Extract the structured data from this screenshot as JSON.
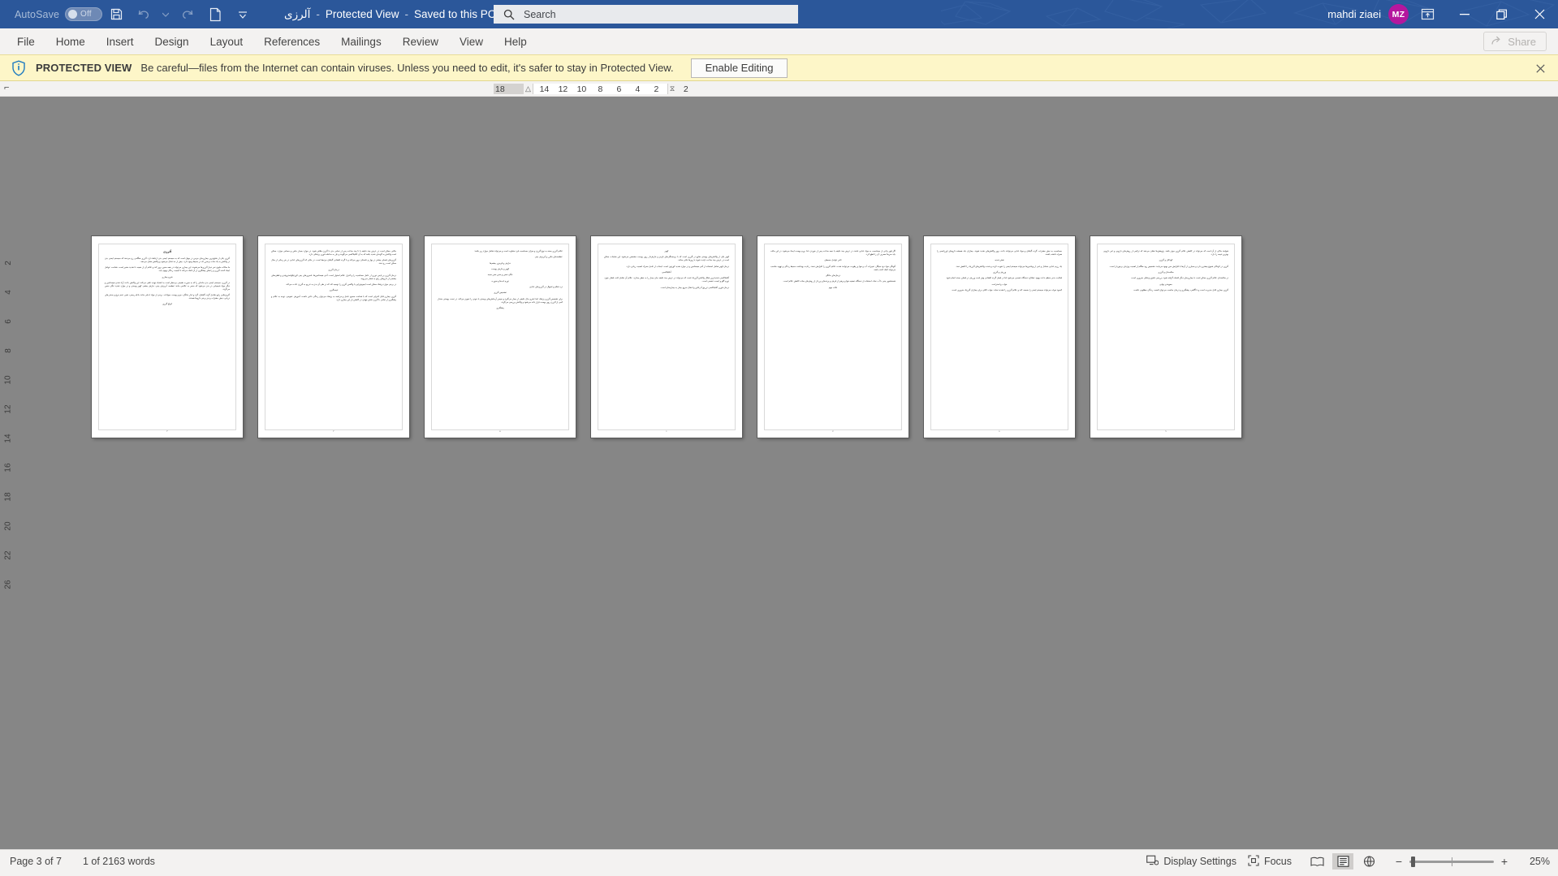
{
  "titlebar": {
    "autosave_label": "AutoSave",
    "autosave_state": "Off",
    "doc_name": "آلرزی",
    "protected_view": "Protected View",
    "saved_state": "Saved to this PC",
    "sep": "-",
    "caret": "▾",
    "icons": [
      "save-icon",
      "undo-icon",
      "redo-icon",
      "new-document-icon",
      "customize-quick-access-icon"
    ],
    "user_name": "mahdi ziaei",
    "user_initials": "MZ",
    "avatar_color": "#b5179e",
    "bar_color": "#2b579a",
    "window_controls": [
      "ribbon-display-options",
      "minimize",
      "restore",
      "close"
    ]
  },
  "search": {
    "placeholder": "Search",
    "value": ""
  },
  "ribbon": {
    "tabs": [
      {
        "label": "File"
      },
      {
        "label": "Home"
      },
      {
        "label": "Insert"
      },
      {
        "label": "Design"
      },
      {
        "label": "Layout"
      },
      {
        "label": "References"
      },
      {
        "label": "Mailings"
      },
      {
        "label": "Review"
      },
      {
        "label": "View"
      },
      {
        "label": "Help"
      }
    ],
    "share_label": "Share"
  },
  "protected_view_banner": {
    "title": "PROTECTED VIEW",
    "message": "Be careful—files from the Internet can contain viruses. Unless you need to edit, it's safer to stay in Protected View.",
    "button_label": "Enable Editing",
    "close_label": "✕",
    "background": "#fdf6c8"
  },
  "ruler": {
    "horizontal_numbers": [
      "18",
      "14",
      "12",
      "10",
      "8",
      "6",
      "4",
      "2",
      "2"
    ],
    "left_value": "18",
    "vertical_numbers": [
      "2",
      "4",
      "6",
      "8",
      "10",
      "12",
      "14",
      "16",
      "18",
      "20",
      "22",
      "26"
    ],
    "tab_stop_glyph": "⌐"
  },
  "statusbar": {
    "page_status": "Page 3 of 7",
    "word_count": "1 of 2163 words",
    "display_settings": "Display Settings",
    "focus": "Focus",
    "zoom_percent": "25%",
    "zoom_minus": "−",
    "zoom_plus": "+",
    "view_modes": [
      "read-mode",
      "print-layout",
      "web-layout"
    ],
    "active_view_mode": "print-layout"
  },
  "document": {
    "pages": [
      {
        "number": "۳",
        "title": "آلرژی",
        "paragraphs": [
          "آلرژی یکی از شایع‌ترین بیماری‌های مزمن در جهان است که به سیستم ایمنی بدن ارتباط دارد. آلرژی هنگامی رخ می‌دهد که سیستم ایمنی بدن در واکنش به یک ماده بی‌ضرر که در محیط وجود دارد، بیش از حد فعال می‌شود و واکنش نشان می‌دهد.",
          "ما سالانه ملیون نفر دچار آلرژی‌ها می‌شوند. این بیماری می‌تواند در همه سنین بروز کند و علائم آن از خفیف تا شدید متغیر است. شناخت عوامل ایجاد کننده آلرژی و راه‌های پیشگیری از آن کمک می‌کند تا کیفیت زندگی بهبود یابد.",
          "شرح بیماری",
          "در آلرژی، سیستم ایمنی بدن ماده‌ای را که به صورت طبیعی بی‌خطر است به اشتباه تهدید تلقی می‌کند. این واکنش باعث آزاد شدن هیستامین و دیگر مواد شیمیایی در بدن می‌شود که منجر به علائمی مانند عطسه، آبریزش بینی، خارش چشم، کهیر پوستی و در موارد شدید تنگی نفس می‌گردد.",
          "آلرژن‌هایی رایج شامل گرده گیاهان، گرد و غبار خانگی، مو و پوست حیوانات، برخی از مواد غذایی مانند بادام زمینی، شیر، تخم مرغ و صدف‌های دریایی، نیش حشرات و نیز برخی داروها هستند.",
          "انواع آلرژی"
        ]
      },
      {
        "number": "۴",
        "paragraphs": [
          "حالتی ممکن است در عرض چند دقیقه یا تا چند ساعت پس از تماس بدن با آلرژن ظاهر شود. در موارد بسیار خاص و حساس موارد، ممکن است واکنش به گونه‌ای شدید باشد که به آن آنافیلاکسی می‌گویند و نیاز به مداخله فوری پزشکی دارد.",
          "آلرژی‌های فصلی بیشتر در بهار و تابستان بروز می‌کند و با گرده افشانی گیاهان مرتبط است. در حالی که آلرژی‌های غذایی در هر زمانی از سال ممکن است رخ دهد.",
          "درمان آلرژی",
          "درمان آلرژی بر پایه‌ی دوری از عامل حساسیت زا و کنترل علائم استوار است. آنتی هیستامین‌ها، اسپری‌های بینی کورتیکواستروئیدی و قطره‌های چشمی از داروهای رایج به شمار می‌روند.",
          "در برخی موارد پزشک ممکن است ایمونوتراپی یا واکسن آلرژی را توصیه کند که در طی آن بدن به تدریج به آلرژن عادت می‌کند.",
          "نتیجه‌گیری",
          "آلرژی بیماری قابل کنترلی است که با شناخت صحیح عامل و مراجعه به پزشک می‌توان زندگی عادی داشت. آموزش عمومی، توجه به علائم و پیشگیری از تماس با آلرژن نقش مهمی در کاهش بار این بیماری دارد."
        ]
      },
      {
        "number": "۵",
        "paragraphs": [
          "علائم آلرژی بسته به نوع آلرژن و میزان حساسیت فرد متفاوت است و می‌تواند شامل موارد زیر باشد:",
          "عطسه‌های مکرر و آبریزش بینی",
          "خارش و قرمزی چشم‌ها",
          "کهیر و خارش پوست",
          "تنگی نفس و خس خس سینه",
          "تورم لب‌ها و صورت",
          "درد شکم و اسهال در آلرژی‌های غذایی",
          "تشخیص آلرژی",
          "برای تشخیص آلرژی پزشک ابتدا شرح حال دقیقی از بیمار می‌گیرد و سپس آزمایش‌های پوستی یا خونی را تجویز می‌کند. در تست پوستی مقدار کمی از آلرژن روی پوست قرار داده می‌شود و واکنش بررسی می‌گردد.",
          "پیشگیری"
        ]
      },
      {
        "number": "۶",
        "paragraphs": [
          "کهیر",
          "کهیر یکی از واکنش‌های پوستی شایع در آلرژی است که با برجستگی‌های قرمز و خارش‌دار روی پوست مشخص می‌شود. این ضایعات ممکن است در عرض چند ساعت ناپدید شوند یا روزها باقی بمانند.",
          "درمان کهیر شامل استفاده از آنتی هیستامین و در موارد شدید کورتون است. اجتناب از عامل محرک اهمیت زیادی دارد.",
          "آنافیلاکسی",
          "آنافیلاکسی شدیدترین شکل واکنش آلرژیک است که می‌تواند در عرض چند دقیقه جان بیمار را به خطر بیندازد. علائم آن شامل افت فشار خون، تورم گلو و ایست تنفسی است.",
          "درمان فوری آنافیلاکسی تزریق آدرنالین و انتقال سریع بیمار به بیمارستان است."
        ]
      },
      {
        "number": "۷",
        "paragraphs": [
          "اگر قهر بدانی از حساسیت به مواد غذایی باشد، در عرض چند دقیقه یا نیمه ساعت پس از خوردن غذا، ورم پوست ایجاد می‌شود. در این حالت باید سریعاً مصرف آن را قطع کرد.",
          "تاثیر عوامل محیطی",
          "آلودگی هوا، دود سیگار، تغییرات آب و هوا و رطوبت می‌توانند شدت علائم آلرژی را افزایش دهند. رعایت بهداشت محیط زندگی و تهویه مناسب می‌تواند کمک کننده باشد.",
          "درمان‌های خانگی",
          "شستشوی بینی با آب نمک، استفاده از دستگاه تصفیه هوا و پرهیز از فرش و پرده‌های پرزدار از روش‌های ساده کاهش علائم است.",
          "نکات مهم"
        ]
      },
      {
        "number": "۸",
        "paragraphs": [
          "حساسیت به نیش حشرات، گرده گیاهان و مواد غذایی می‌توانند باعث بروز واکنش‌های شدید شوند. بیماران باید همیشه داروهای اورژانسی را همراه داشته باشند.",
          "نقش تغذیه",
          "یک رژیم غذایی متعادل و غنی از ویتامین‌ها می‌تواند سیستم ایمنی را تقویت کرده و شدت واکنش‌های آلرژیک را کاهش دهد.",
          "ورزش و آلرژی",
          "فعالیت بدنی منظم باعث بهبود عملکرد دستگاه تنفسی می‌شود اما در فصل گرده افشانی بهتر است ورزش در فضای بسته انجام شود.",
          "خواب و استراحت",
          "کمبود خواب می‌تواند سیستم ایمنی را ضعیف کند و علائم آلرژی را تشدید نماید. خواب کافی برای بیماران آلرژیک ضروری است."
        ]
      },
      {
        "number": "۹",
        "paragraphs": [
          "شواهد حاکی از آن است که می‌تواند در کاهش علائم آلرژی موثر باشد. پژوهش‌ها نشان می‌دهد که ترکیبی از روش‌های دارویی و غیر دارویی بهترین نتیجه را دارد.",
          "کودکان و آلرژی",
          "آلرژی در کودکان شیوع بیشتری دارد و بسیاری از آن‌ها با افزایش سن بهبود می‌یابند. تشخیص زود هنگام از اهمیت ویژه‌ای برخوردار است.",
          "سالمندان و آلرژی",
          "در سالمندان علائم آلرژی ممکن است با بیماری‌های دیگر اشتباه گرفته شود. بررسی دقیق پزشکی ضروری است.",
          "جمع‌بندی نهایی",
          "آلرژی بیماری قابل مدیریت است و با آگاهی، پیشگیری و درمان مناسب می‌توان کیفیت زندگی مطلوبی داشت."
        ]
      }
    ]
  }
}
